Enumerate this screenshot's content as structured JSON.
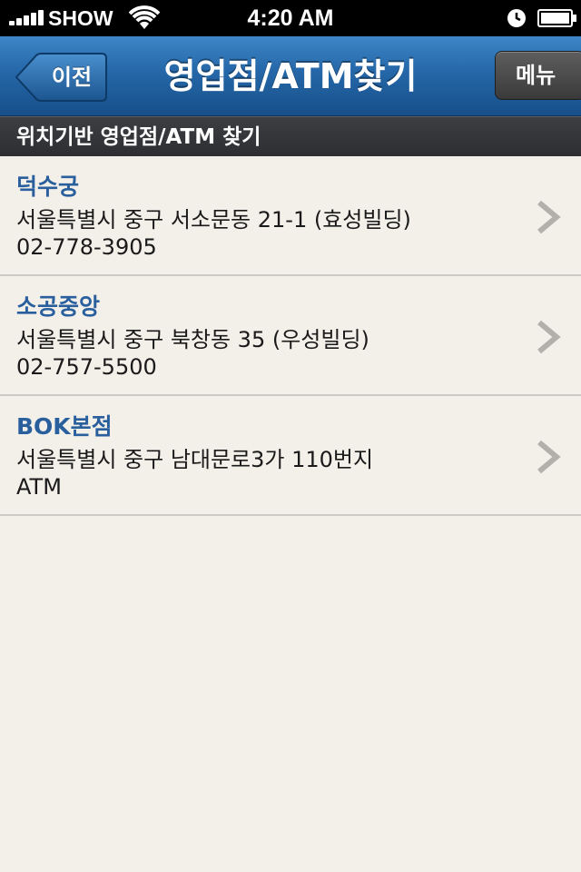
{
  "status_bar": {
    "carrier": "SHOW",
    "time": "4:20 AM",
    "icons": [
      "signal-icon",
      "wifi-icon",
      "clock-icon",
      "battery-icon"
    ]
  },
  "nav_bar": {
    "back_label": "이전",
    "title": "영업점/ATM찾기",
    "menu_label": "메뉴"
  },
  "section": {
    "title": "위치기반 영업점/ATM 찾기"
  },
  "results": [
    {
      "name": "덕수궁",
      "address": "서울특별시 중구 서소문동 21-1 (효성빌딩)",
      "detail": "02-778-3905"
    },
    {
      "name": "소공중앙",
      "address": "서울특별시 중구 북창동 35 (우성빌딩)",
      "detail": "02-757-5500"
    },
    {
      "name": "BOK본점",
      "address": "서울특별시 중구 남대문로3가 110번지",
      "detail": "ATM"
    }
  ],
  "colors": {
    "nav_blue": "#2567a8",
    "name_blue": "#2a5f9e",
    "background": "#f3efe9",
    "section_header": "#2c2e31"
  }
}
